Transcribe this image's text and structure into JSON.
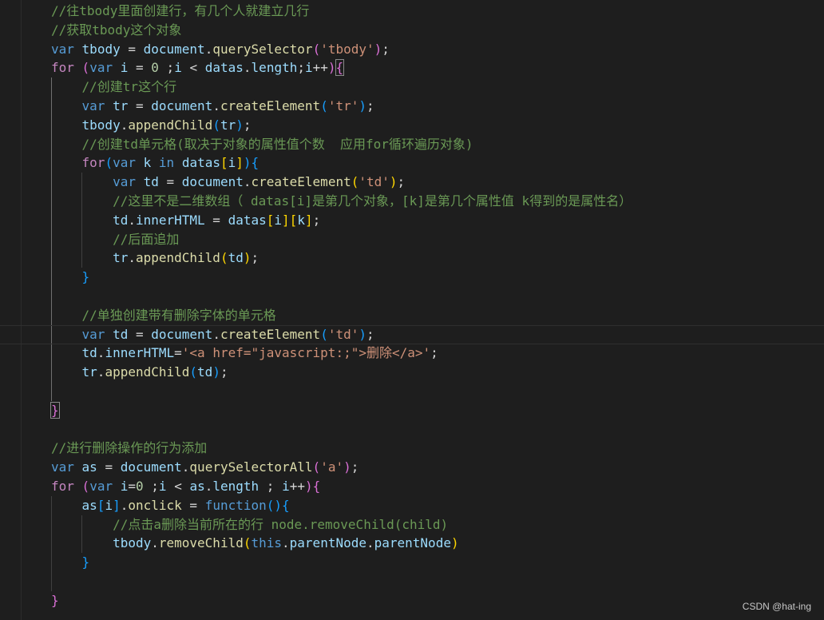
{
  "colors": {
    "background": "#1e1e1e",
    "comment": "#6a9955",
    "keyword": "#569cd6",
    "control": "#c586c0",
    "variable": "#9cdcfe",
    "function": "#dcdcaa",
    "string": "#ce9178",
    "number": "#b5cea8",
    "plain": "#d4d4d4",
    "bracket_gold": "#ffd700",
    "bracket_purple": "#da70d6",
    "bracket_blue": "#179fff"
  },
  "code_lines": [
    [
      {
        "t": "//往tbody里面创建行，有几个人就建立几行",
        "c": "comment"
      }
    ],
    [
      {
        "t": "//获取tbody这个对象",
        "c": "comment"
      }
    ],
    [
      {
        "t": "var",
        "c": "keyword"
      },
      {
        "t": " "
      },
      {
        "t": "tbody",
        "c": "variable"
      },
      {
        "t": " = "
      },
      {
        "t": "document",
        "c": "variable"
      },
      {
        "t": "."
      },
      {
        "t": "querySelector",
        "c": "function"
      },
      {
        "t": "(",
        "c": "bracket_purple"
      },
      {
        "t": "'tbody'",
        "c": "string"
      },
      {
        "t": ")",
        "c": "bracket_purple"
      },
      {
        "t": ";"
      }
    ],
    [
      {
        "t": "for",
        "c": "control"
      },
      {
        "t": " "
      },
      {
        "t": "(",
        "c": "bracket_purple"
      },
      {
        "t": "var",
        "c": "keyword"
      },
      {
        "t": " "
      },
      {
        "t": "i",
        "c": "variable"
      },
      {
        "t": " = "
      },
      {
        "t": "0",
        "c": "number"
      },
      {
        "t": " ;"
      },
      {
        "t": "i",
        "c": "variable"
      },
      {
        "t": " < "
      },
      {
        "t": "datas",
        "c": "variable"
      },
      {
        "t": "."
      },
      {
        "t": "length",
        "c": "variable"
      },
      {
        "t": ";"
      },
      {
        "t": "i",
        "c": "variable"
      },
      {
        "t": "++"
      },
      {
        "t": ")",
        "c": "bracket_purple"
      },
      {
        "t": "{",
        "c": "bracket_purple",
        "box": true
      }
    ],
    [
      {
        "t": "    "
      },
      {
        "t": "//创建tr这个行",
        "c": "comment"
      }
    ],
    [
      {
        "t": "    "
      },
      {
        "t": "var",
        "c": "keyword"
      },
      {
        "t": " "
      },
      {
        "t": "tr",
        "c": "variable"
      },
      {
        "t": " = "
      },
      {
        "t": "document",
        "c": "variable"
      },
      {
        "t": "."
      },
      {
        "t": "createElement",
        "c": "function"
      },
      {
        "t": "(",
        "c": "bracket_blue"
      },
      {
        "t": "'tr'",
        "c": "string"
      },
      {
        "t": ")",
        "c": "bracket_blue"
      },
      {
        "t": ";"
      }
    ],
    [
      {
        "t": "    "
      },
      {
        "t": "tbody",
        "c": "variable"
      },
      {
        "t": "."
      },
      {
        "t": "appendChild",
        "c": "function"
      },
      {
        "t": "(",
        "c": "bracket_blue"
      },
      {
        "t": "tr",
        "c": "variable"
      },
      {
        "t": ")",
        "c": "bracket_blue"
      },
      {
        "t": ";"
      }
    ],
    [
      {
        "t": "    "
      },
      {
        "t": "//创建td单元格(取决于对象的属性值个数  应用for循环遍历对象)",
        "c": "comment"
      }
    ],
    [
      {
        "t": "    "
      },
      {
        "t": "for",
        "c": "control"
      },
      {
        "t": "(",
        "c": "bracket_blue"
      },
      {
        "t": "var",
        "c": "keyword"
      },
      {
        "t": " "
      },
      {
        "t": "k",
        "c": "variable"
      },
      {
        "t": " "
      },
      {
        "t": "in",
        "c": "keyword"
      },
      {
        "t": " "
      },
      {
        "t": "datas",
        "c": "variable"
      },
      {
        "t": "[",
        "c": "bracket_gold"
      },
      {
        "t": "i",
        "c": "variable"
      },
      {
        "t": "]",
        "c": "bracket_gold"
      },
      {
        "t": ")",
        "c": "bracket_blue"
      },
      {
        "t": "{",
        "c": "bracket_blue"
      }
    ],
    [
      {
        "t": "        "
      },
      {
        "t": "var",
        "c": "keyword"
      },
      {
        "t": " "
      },
      {
        "t": "td",
        "c": "variable"
      },
      {
        "t": " = "
      },
      {
        "t": "document",
        "c": "variable"
      },
      {
        "t": "."
      },
      {
        "t": "createElement",
        "c": "function"
      },
      {
        "t": "(",
        "c": "bracket_gold"
      },
      {
        "t": "'td'",
        "c": "string"
      },
      {
        "t": ")",
        "c": "bracket_gold"
      },
      {
        "t": ";"
      }
    ],
    [
      {
        "t": "        "
      },
      {
        "t": "//这里不是二维数组（ datas[i]是第几个对象，[k]是第几个属性值 k得到的是属性名）",
        "c": "comment"
      }
    ],
    [
      {
        "t": "        "
      },
      {
        "t": "td",
        "c": "variable"
      },
      {
        "t": "."
      },
      {
        "t": "innerHTML",
        "c": "variable"
      },
      {
        "t": " = "
      },
      {
        "t": "datas",
        "c": "variable"
      },
      {
        "t": "[",
        "c": "bracket_gold"
      },
      {
        "t": "i",
        "c": "variable"
      },
      {
        "t": "]",
        "c": "bracket_gold"
      },
      {
        "t": "[",
        "c": "bracket_gold"
      },
      {
        "t": "k",
        "c": "variable"
      },
      {
        "t": "]",
        "c": "bracket_gold"
      },
      {
        "t": ";"
      }
    ],
    [
      {
        "t": "        "
      },
      {
        "t": "//后面追加",
        "c": "comment"
      }
    ],
    [
      {
        "t": "        "
      },
      {
        "t": "tr",
        "c": "variable"
      },
      {
        "t": "."
      },
      {
        "t": "appendChild",
        "c": "function"
      },
      {
        "t": "(",
        "c": "bracket_gold"
      },
      {
        "t": "td",
        "c": "variable"
      },
      {
        "t": ")",
        "c": "bracket_gold"
      },
      {
        "t": ";"
      }
    ],
    [
      {
        "t": "    "
      },
      {
        "t": "}",
        "c": "bracket_blue"
      }
    ],
    [],
    [
      {
        "t": "    "
      },
      {
        "t": "//单独创建带有删除字体的单元格",
        "c": "comment"
      }
    ],
    [
      {
        "t": "    "
      },
      {
        "t": "var",
        "c": "keyword"
      },
      {
        "t": " "
      },
      {
        "t": "td",
        "c": "variable"
      },
      {
        "t": " = "
      },
      {
        "t": "document",
        "c": "variable"
      },
      {
        "t": "."
      },
      {
        "t": "createElement",
        "c": "function"
      },
      {
        "t": "(",
        "c": "bracket_blue"
      },
      {
        "t": "'td'",
        "c": "string"
      },
      {
        "t": ")",
        "c": "bracket_blue"
      },
      {
        "t": ";"
      }
    ],
    [
      {
        "t": "    "
      },
      {
        "t": "td",
        "c": "variable"
      },
      {
        "t": "."
      },
      {
        "t": "innerHTML",
        "c": "variable"
      },
      {
        "t": "="
      },
      {
        "t": "'<a href=\"javascript:;\">删除</a>'",
        "c": "string"
      },
      {
        "t": ";"
      }
    ],
    [
      {
        "t": "    "
      },
      {
        "t": "tr",
        "c": "variable"
      },
      {
        "t": "."
      },
      {
        "t": "appendChild",
        "c": "function"
      },
      {
        "t": "(",
        "c": "bracket_blue"
      },
      {
        "t": "td",
        "c": "variable"
      },
      {
        "t": ")",
        "c": "bracket_blue"
      },
      {
        "t": ";"
      }
    ],
    [],
    [
      {
        "t": "}",
        "c": "bracket_purple",
        "box": true
      }
    ],
    [],
    [
      {
        "t": "//进行删除操作的行为添加",
        "c": "comment"
      }
    ],
    [
      {
        "t": "var",
        "c": "keyword"
      },
      {
        "t": " "
      },
      {
        "t": "as",
        "c": "variable"
      },
      {
        "t": " = "
      },
      {
        "t": "document",
        "c": "variable"
      },
      {
        "t": "."
      },
      {
        "t": "querySelectorAll",
        "c": "function"
      },
      {
        "t": "(",
        "c": "bracket_purple"
      },
      {
        "t": "'a'",
        "c": "string"
      },
      {
        "t": ")",
        "c": "bracket_purple"
      },
      {
        "t": ";"
      }
    ],
    [
      {
        "t": "for",
        "c": "control"
      },
      {
        "t": " "
      },
      {
        "t": "(",
        "c": "bracket_purple"
      },
      {
        "t": "var",
        "c": "keyword"
      },
      {
        "t": " "
      },
      {
        "t": "i",
        "c": "variable"
      },
      {
        "t": "="
      },
      {
        "t": "0",
        "c": "number"
      },
      {
        "t": " ;"
      },
      {
        "t": "i",
        "c": "variable"
      },
      {
        "t": " < "
      },
      {
        "t": "as",
        "c": "variable"
      },
      {
        "t": "."
      },
      {
        "t": "length",
        "c": "variable"
      },
      {
        "t": " ; "
      },
      {
        "t": "i",
        "c": "variable"
      },
      {
        "t": "++"
      },
      {
        "t": ")",
        "c": "bracket_purple"
      },
      {
        "t": "{",
        "c": "bracket_purple"
      }
    ],
    [
      {
        "t": "    "
      },
      {
        "t": "as",
        "c": "variable"
      },
      {
        "t": "[",
        "c": "bracket_blue"
      },
      {
        "t": "i",
        "c": "variable"
      },
      {
        "t": "]",
        "c": "bracket_blue"
      },
      {
        "t": "."
      },
      {
        "t": "onclick",
        "c": "function"
      },
      {
        "t": " = "
      },
      {
        "t": "function",
        "c": "keyword"
      },
      {
        "t": "(",
        "c": "bracket_blue"
      },
      {
        "t": ")",
        "c": "bracket_blue"
      },
      {
        "t": "{",
        "c": "bracket_blue"
      }
    ],
    [
      {
        "t": "        "
      },
      {
        "t": "//点击a删除当前所在的行 node.removeChild(child)",
        "c": "comment"
      }
    ],
    [
      {
        "t": "        "
      },
      {
        "t": "tbody",
        "c": "variable"
      },
      {
        "t": "."
      },
      {
        "t": "removeChild",
        "c": "function"
      },
      {
        "t": "(",
        "c": "bracket_gold"
      },
      {
        "t": "this",
        "c": "keyword"
      },
      {
        "t": "."
      },
      {
        "t": "parentNode",
        "c": "variable"
      },
      {
        "t": "."
      },
      {
        "t": "parentNode",
        "c": "variable"
      },
      {
        "t": ")",
        "c": "bracket_gold"
      }
    ],
    [
      {
        "t": "    "
      },
      {
        "t": "}",
        "c": "bracket_blue"
      }
    ],
    [],
    [
      {
        "t": "}",
        "c": "bracket_purple"
      }
    ]
  ],
  "watermark": "CSDN @hat-ing"
}
